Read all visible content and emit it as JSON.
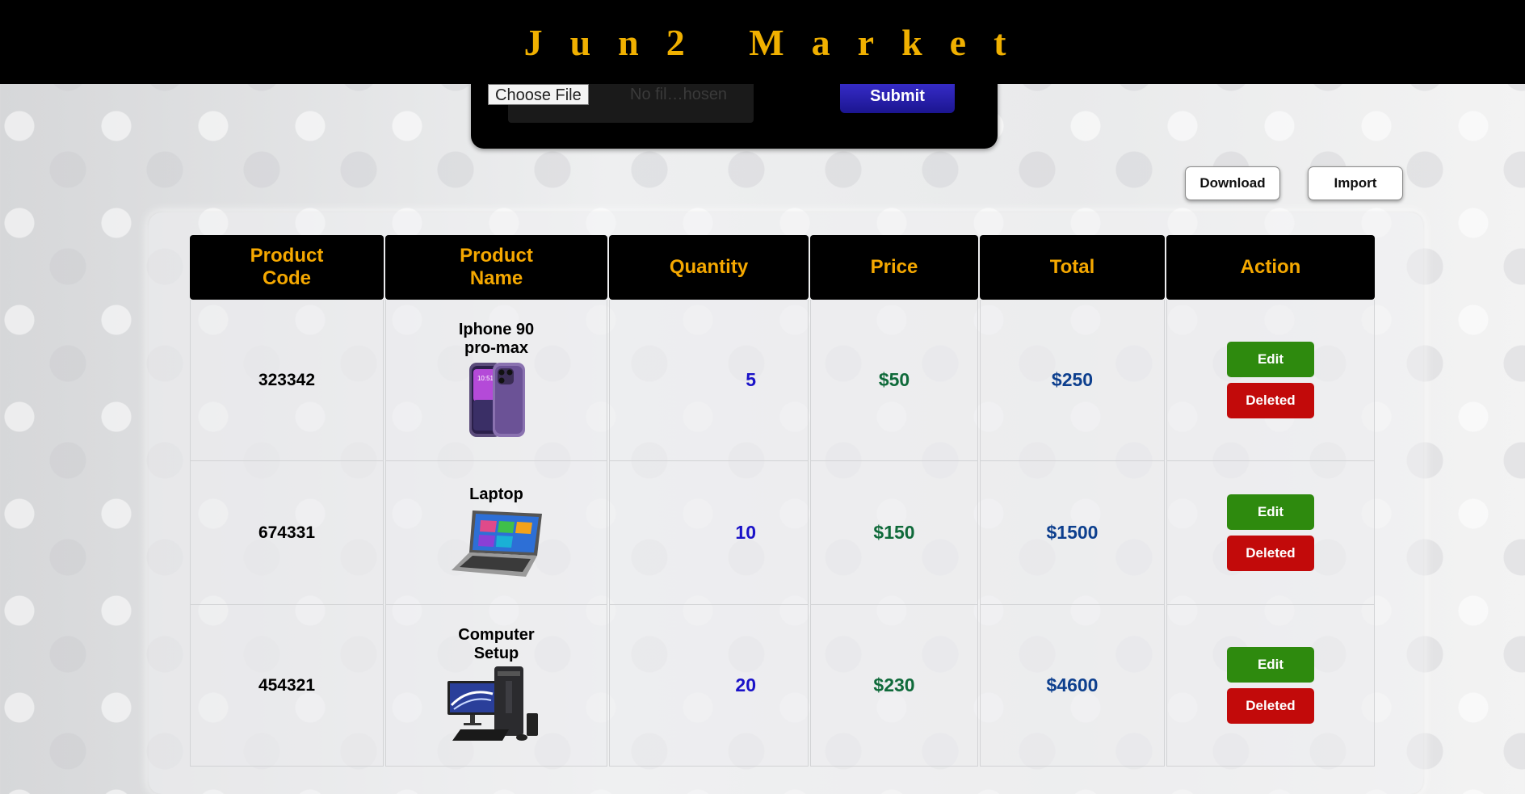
{
  "header": {
    "brand": "Jun2 Market"
  },
  "upload": {
    "choose_label": "Choose File",
    "file_status": "No fil…hosen",
    "submit_label": "Submit"
  },
  "toolbar": {
    "download_label": "Download",
    "import_label": "Import"
  },
  "table": {
    "headers": {
      "code": [
        "Product",
        "Code"
      ],
      "name": [
        "Product",
        "Name"
      ],
      "quantity": "Quantity",
      "price": "Price",
      "total": "Total",
      "action": "Action"
    },
    "rows": [
      {
        "code": "323342",
        "name": [
          "Iphone 90",
          "pro-max"
        ],
        "image": "iphone-image",
        "quantity": "5",
        "price": "$50",
        "total": "$250",
        "edit": "Edit",
        "delete": "Deleted"
      },
      {
        "code": "674331",
        "name": [
          "Laptop"
        ],
        "image": "laptop-image",
        "quantity": "10",
        "price": "$150",
        "total": "$1500",
        "edit": "Edit",
        "delete": "Deleted"
      },
      {
        "code": "454321",
        "name": [
          "Computer",
          "Setup"
        ],
        "image": "computer-setup-image",
        "quantity": "20",
        "price": "$230",
        "total": "$4600",
        "edit": "Edit",
        "delete": "Deleted"
      }
    ]
  },
  "colors": {
    "header_bg": "#000000",
    "header_text": "#f5a800",
    "submit_bg": "#2a22b8",
    "edit_bg": "#2e8a0e",
    "delete_bg": "#c20a0a",
    "quantity_text": "#1a12c8",
    "price_text": "#0f6a3a",
    "total_text": "#0d3f8e"
  }
}
